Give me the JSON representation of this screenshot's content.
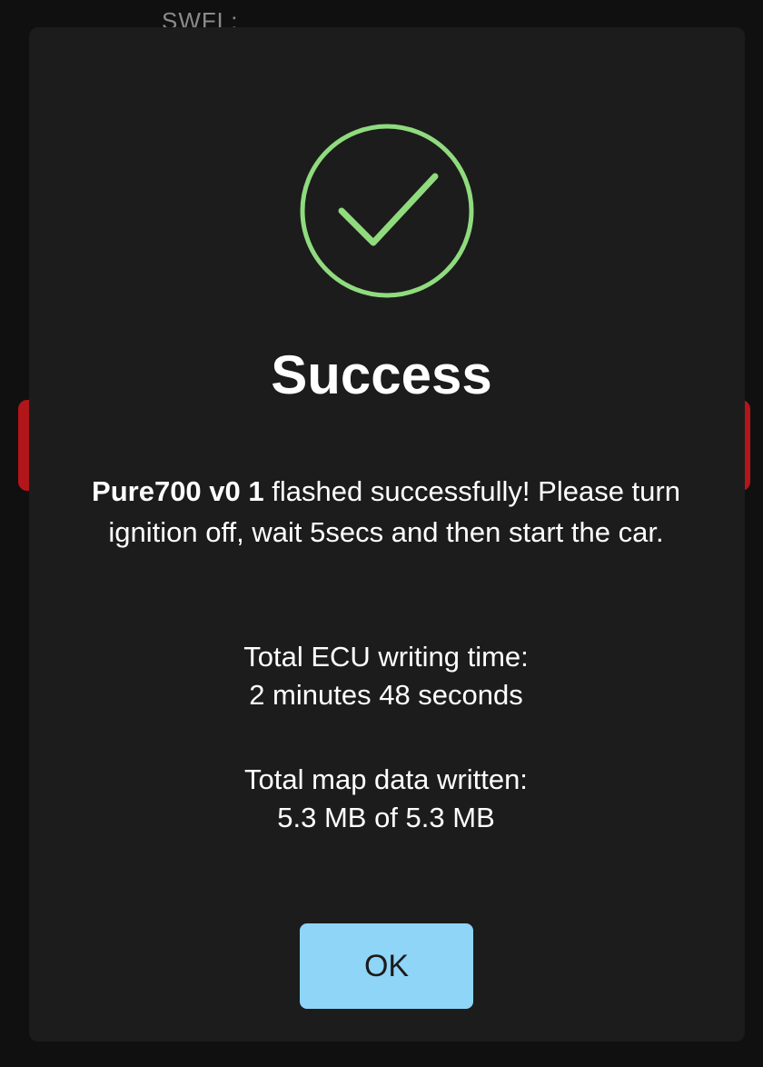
{
  "background": {
    "peek_text": "SWFL:"
  },
  "dialog": {
    "icon": "check-circle-icon",
    "title": "Success",
    "message": {
      "product": "Pure700 v0 1",
      "text": " flashed successfully! Please turn ignition off, wait 5secs and then start the car."
    },
    "writing_time": {
      "label": "Total ECU writing time:",
      "value": "2 minutes 48 seconds"
    },
    "map_data": {
      "label": "Total map data written:",
      "value": "5.3 MB of 5.3 MB"
    },
    "ok_label": "OK"
  },
  "colors": {
    "dialog_bg": "#1c1c1c",
    "success_green": "#8fdb7e",
    "button_bg": "#8fd5f8",
    "danger_red": "#b3161a"
  }
}
